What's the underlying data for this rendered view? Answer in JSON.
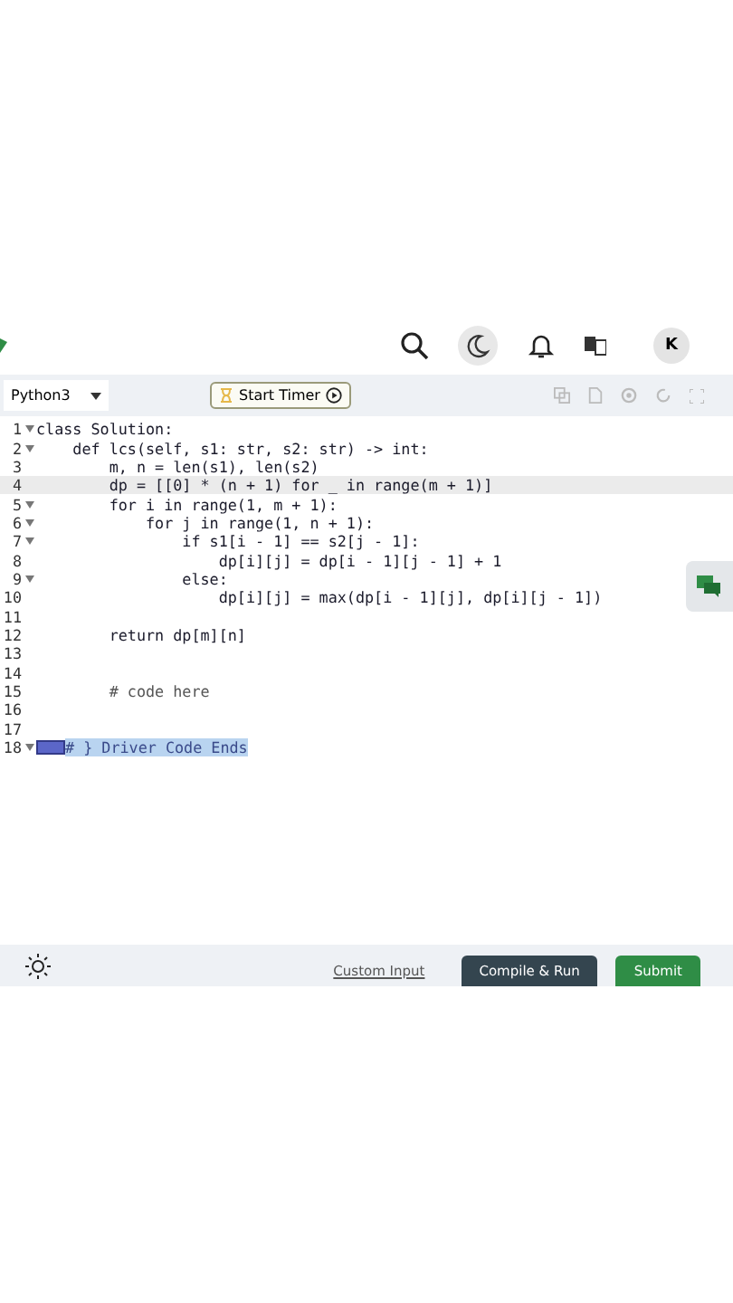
{
  "header": {
    "avatar": "K"
  },
  "toolbar": {
    "language": "Python3",
    "timer_button": "Start Timer"
  },
  "editor": {
    "lines": [
      {
        "number": "1",
        "foldable": true,
        "current": false,
        "selected": false,
        "kind": "code",
        "text": "class Solution:"
      },
      {
        "number": "2",
        "foldable": true,
        "current": false,
        "selected": false,
        "kind": "code",
        "text": "    def lcs(self, s1: str, s2: str) -> int:"
      },
      {
        "number": "3",
        "foldable": false,
        "current": false,
        "selected": false,
        "kind": "code",
        "text": "        m, n = len(s1), len(s2)"
      },
      {
        "number": "4",
        "foldable": false,
        "current": true,
        "selected": false,
        "kind": "code",
        "text": "        dp = [[0] * (n + 1) for _ in range(m + 1)]"
      },
      {
        "number": "5",
        "foldable": true,
        "current": false,
        "selected": false,
        "kind": "code",
        "text": "        for i in range(1, m + 1):"
      },
      {
        "number": "6",
        "foldable": true,
        "current": false,
        "selected": false,
        "kind": "code",
        "text": "            for j in range(1, n + 1):"
      },
      {
        "number": "7",
        "foldable": true,
        "current": false,
        "selected": false,
        "kind": "code",
        "text": "                if s1[i - 1] == s2[j - 1]:"
      },
      {
        "number": "8",
        "foldable": false,
        "current": false,
        "selected": false,
        "kind": "code",
        "text": "                    dp[i][j] = dp[i - 1][j - 1] + 1"
      },
      {
        "number": "9",
        "foldable": true,
        "current": false,
        "selected": false,
        "kind": "code",
        "text": "                else:"
      },
      {
        "number": "10",
        "foldable": false,
        "current": false,
        "selected": false,
        "kind": "code",
        "text": "                    dp[i][j] = max(dp[i - 1][j], dp[i][j - 1])"
      },
      {
        "number": "11",
        "foldable": false,
        "current": false,
        "selected": false
      },
      {
        "number": "12",
        "foldable": false,
        "current": false,
        "selected": false,
        "kind": "code",
        "text": "        return dp[m][n]"
      },
      {
        "number": "13",
        "foldable": false,
        "current": false,
        "selected": false
      },
      {
        "number": "14",
        "foldable": false,
        "current": false,
        "selected": false
      },
      {
        "number": "15",
        "foldable": false,
        "current": false,
        "selected": false,
        "kind": "comment",
        "text": "        # code here"
      },
      {
        "number": "16",
        "foldable": false,
        "current": false,
        "selected": false
      },
      {
        "number": "17",
        "foldable": false,
        "current": false,
        "selected": false
      },
      {
        "number": "18",
        "foldable": true,
        "current": false,
        "selected": true,
        "kind": "comment",
        "text": "# } Driver Code Ends"
      }
    ]
  },
  "footer": {
    "custom_input": "Custom Input",
    "run_button": "Compile & Run",
    "submit_button": "Submit"
  }
}
